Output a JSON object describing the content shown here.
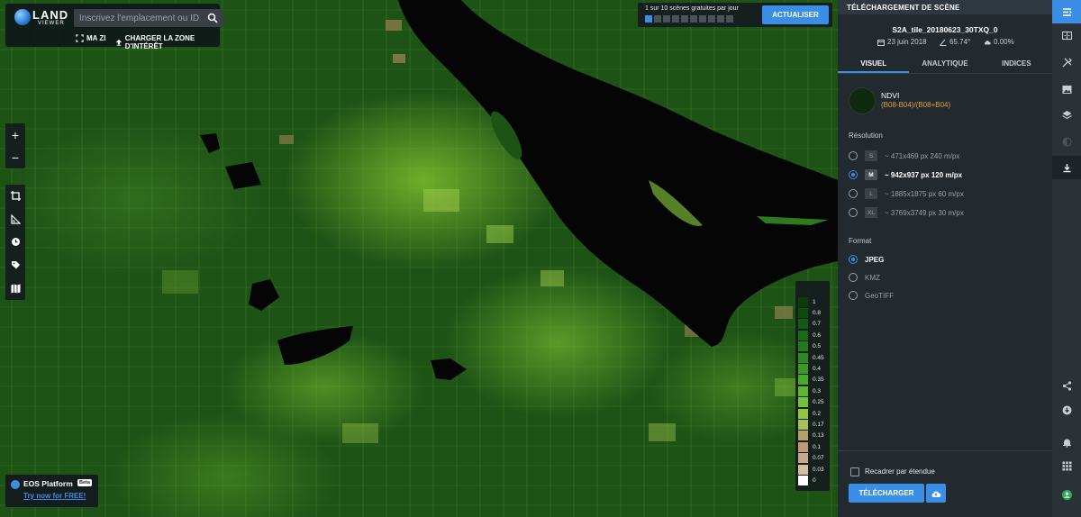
{
  "logo": {
    "top": "LAND",
    "bottom": "VIEWER"
  },
  "search": {
    "placeholder": "Inscrivez l'emplacement ou ID d..."
  },
  "toolbar": {
    "my_aoi": "MA ZI",
    "upload_aoi": "CHARGER LA ZONE D'INTÉRÊT"
  },
  "scenes": {
    "counter_text": "1 sur 10 scènes gratuites par jour",
    "total": 10,
    "used": 1,
    "update_label": "ACTUALISER"
  },
  "map_controls": {
    "zoom_in": "+",
    "zoom_out": "−"
  },
  "legend": {
    "values": [
      "1",
      "0.8",
      "0.7",
      "0.6",
      "0.5",
      "0.45",
      "0.4",
      "0.35",
      "0.3",
      "0.25",
      "0.2",
      "0.17",
      "0.13",
      "0.1",
      "0.07",
      "0.03",
      "0"
    ],
    "colors": [
      "#0b3d0b",
      "#0f4a0f",
      "#135a13",
      "#1a6a17",
      "#237a1b",
      "#2e8a1f",
      "#3a9a24",
      "#4aa82a",
      "#5eb531",
      "#77c03a",
      "#91c944",
      "#a8c05a",
      "#b6a06a",
      "#c09a78",
      "#c8a88a",
      "#d4c0a4",
      "#ffffff"
    ]
  },
  "eos": {
    "title": "EOS Platform",
    "badge": "Beta",
    "link": "Try now for FREE!"
  },
  "panel": {
    "header": "TÉLÉCHARGEMENT DE SCÈNE",
    "scene_id": "S2A_tile_20180623_30TXQ_0",
    "date": "23 juin 2018",
    "angle": "65.74°",
    "cloud": "0.00%",
    "tabs": [
      {
        "label": "VISUEL",
        "active": true
      },
      {
        "label": "ANALYTIQUE",
        "active": false
      },
      {
        "label": "INDICES",
        "active": false
      }
    ],
    "index_name": "NDVI",
    "index_formula": "(B08-B04)/(B08+B04)",
    "resolution_label": "Résolution",
    "resolutions": [
      {
        "size": "S",
        "text": "~ 471x469 px 240 m/px",
        "selected": false
      },
      {
        "size": "M",
        "text": "~ 942x937 px 120 m/px",
        "selected": true
      },
      {
        "size": "L",
        "text": "~ 1885x1875 px 60 m/px",
        "selected": false
      },
      {
        "size": "XL",
        "text": "~ 3769x3749 px 30 m/px",
        "selected": false
      }
    ],
    "format_label": "Format",
    "formats": [
      {
        "text": "JPEG",
        "selected": true
      },
      {
        "text": "KMZ",
        "selected": false
      },
      {
        "text": "GeoTIFF",
        "selected": false
      }
    ],
    "crop_label": "Recadrer par étendue",
    "download_label": "TÉLÉCHARGER"
  },
  "rail": {
    "icons": [
      "menu-icon",
      "compare-icon",
      "tools-icon",
      "image-icon",
      "layers-icon",
      "contrast-icon",
      "download-icon",
      "share-icon",
      "download-circle-icon",
      "bell-icon",
      "grid-icon",
      "user-icon"
    ]
  },
  "colors": {
    "accent": "#3a8ee6",
    "panel_bg": "#22292f",
    "formula": "#e0a040"
  }
}
